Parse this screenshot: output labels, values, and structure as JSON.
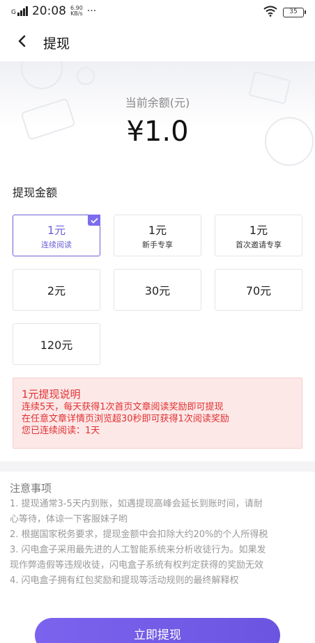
{
  "status_bar": {
    "carrier": "G",
    "time": "20:08",
    "net_speed_value": "6.90",
    "net_speed_unit": "KB/s",
    "more": "···",
    "battery": "35"
  },
  "nav": {
    "title": "提现"
  },
  "balance": {
    "label": "当前余额(元)",
    "value": "¥1.0"
  },
  "amount_section": {
    "title": "提现金额",
    "options": [
      {
        "amount": "1元",
        "sub": "连续阅读",
        "selected": true
      },
      {
        "amount": "1元",
        "sub": "新手专享",
        "selected": false
      },
      {
        "amount": "1元",
        "sub": "首次邀请专享",
        "selected": false
      },
      {
        "amount": "2元",
        "sub": "",
        "selected": false
      },
      {
        "amount": "30元",
        "sub": "",
        "selected": false
      },
      {
        "amount": "70元",
        "sub": "",
        "selected": false
      },
      {
        "amount": "120元",
        "sub": "",
        "selected": false
      }
    ],
    "explain": {
      "title": "1元提现说明",
      "lines": [
        "连续5天，每天获得1次首页文章阅读奖励即可提现",
        "在任意文章详情页浏览超30秒即可获得1次阅读奖励",
        "您已连续阅读：1天"
      ]
    }
  },
  "notes": {
    "title": "注意事项",
    "items": [
      "1. 提现通常3-5天内到账，如遇提现高峰会延长到账时间，请耐",
      "心等待，体谅一下客服妹子哟",
      "2. 根据国家税务要求，提现金额中会扣除大约20%的个人所得税",
      "3. 闪电盒子采用最先进的人工智能系统来分析收徒行为。如果发",
      "现作弊造假等违规收徒，闪电盒子系统有权判定获得的奖励无效",
      "4. 闪电盒子拥有红包奖励和提现等活动规则的最终解释权"
    ]
  },
  "cta": {
    "label": "立即提现"
  },
  "colors": {
    "accent": "#6c5fd6",
    "explain_text": "#e03030",
    "explain_bg": "#fde8e8"
  }
}
